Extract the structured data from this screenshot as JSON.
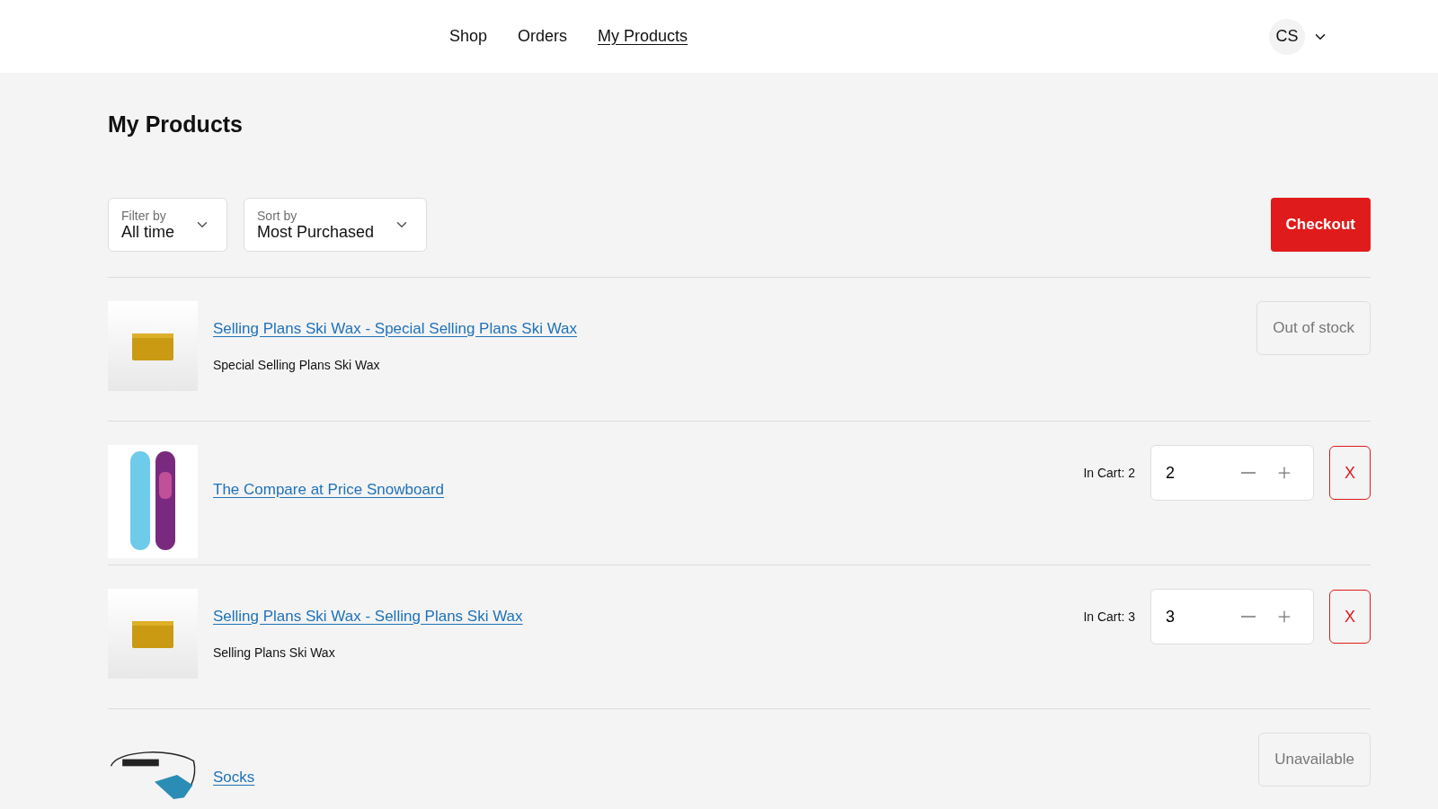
{
  "nav": [
    {
      "label": "Shop",
      "selected": false
    },
    {
      "label": "Orders",
      "selected": false
    },
    {
      "label": "My Products",
      "selected": true
    }
  ],
  "account": {
    "initials": "CS"
  },
  "title": "My Products",
  "filters": [
    {
      "label": "Filter by",
      "value": "All time"
    },
    {
      "label": "Sort by",
      "value": "Most Purchased"
    }
  ],
  "checkout": "Checkout",
  "products": [
    {
      "title": "Selling Plans Ski Wax - Special Selling Plans Ski Wax",
      "subtitle": "Special Selling Plans Ski Wax",
      "kind": "status",
      "status": "Out of stock"
    },
    {
      "title": "The Compare at Price Snowboard",
      "kind": "cart",
      "in_cart": "In Cart: 2",
      "quantity": "2",
      "remove": "X"
    },
    {
      "title": "Selling Plans Ski Wax - Selling Plans Ski Wax",
      "subtitle": "Selling Plans Ski Wax",
      "kind": "cart",
      "in_cart": "In Cart: 3",
      "quantity": "3",
      "remove": "X"
    },
    {
      "title": "Socks",
      "kind": "status",
      "status": "Unavailable"
    }
  ]
}
